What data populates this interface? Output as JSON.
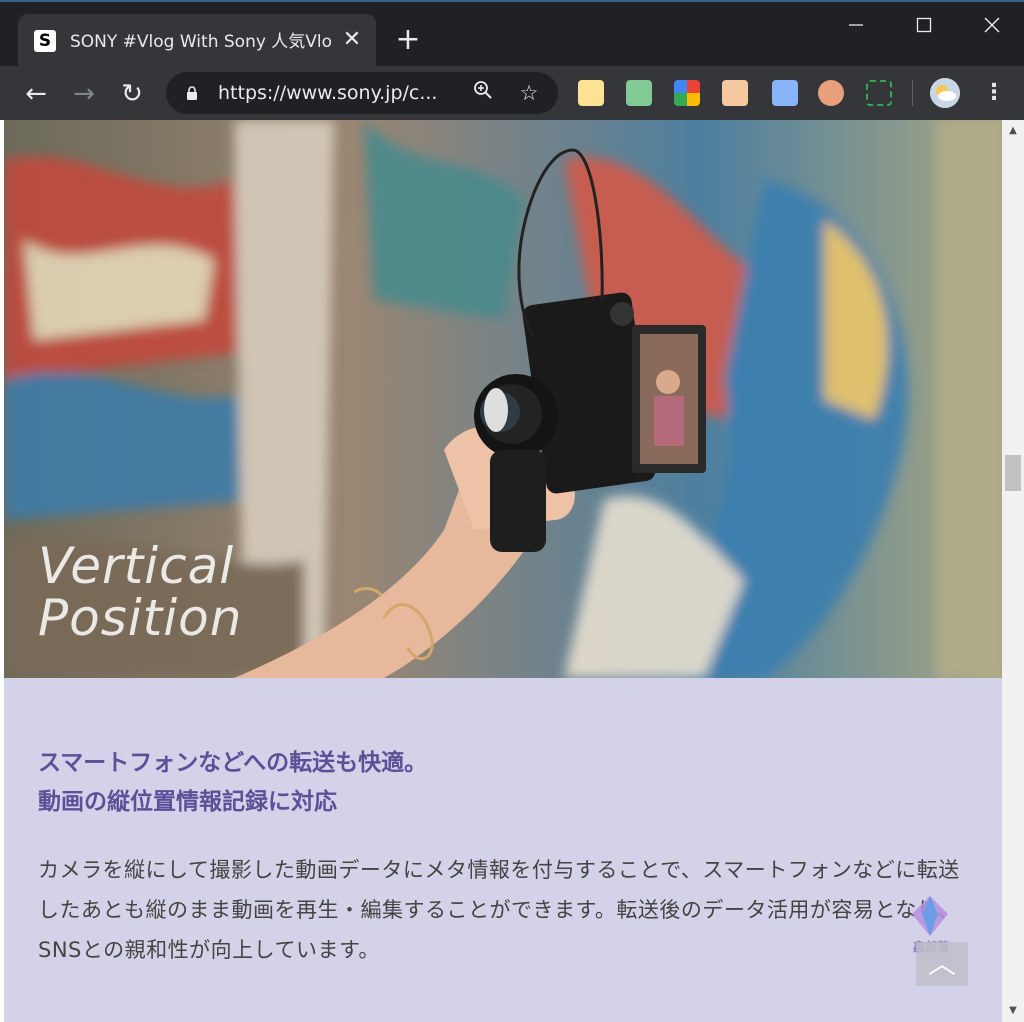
{
  "browser": {
    "tab": {
      "favicon_letter": "S",
      "title": "SONY #Vlog With Sony 人気Vlo",
      "close": "✕"
    },
    "new_tab": "+",
    "window_controls": {
      "minimize": "—",
      "maximize": "☐",
      "close": "✕"
    },
    "nav": {
      "back": "←",
      "forward": "→",
      "reload": "↻"
    },
    "url": "https://www.sony.jp/c...",
    "omnibox_icons": {
      "zoom": "zoom-icon",
      "bookmark": "☆"
    },
    "extensions": [
      {
        "name": "notes-extension-icon",
        "color": "#f4b400"
      },
      {
        "name": "mail-check-extension-icon",
        "color": "#34a853"
      },
      {
        "name": "pinwheel-extension-icon",
        "color": "#ea4335"
      },
      {
        "name": "box-face-extension-icon",
        "color": "#f6c8a0"
      },
      {
        "name": "share-extension-icon",
        "color": "#1a73e8"
      },
      {
        "name": "avatar-extension-icon",
        "color": "#e07050"
      },
      {
        "name": "screen-capture-extension-icon",
        "color": "#34a853"
      }
    ],
    "menu": "⋮"
  },
  "hero": {
    "caption_line1": "Vertical",
    "caption_line2": "Position"
  },
  "content": {
    "heading_line1": "スマートフォンなどへの転送も快適。",
    "heading_line2": "動画の縦位置情報記録に対応",
    "body": "カメラを縦にして撮影した動画データにメタ情報を付与することで、スマートフォンなどに転送したあとも縦のまま動画を再生・編集することができます。転送後のデータ活用が容易となり、SNSとの親和性が向上しています。",
    "watermark_text": "鑫部落",
    "back_to_top": "︿"
  },
  "scrollbar": {
    "up": "▲",
    "down": "▼"
  }
}
